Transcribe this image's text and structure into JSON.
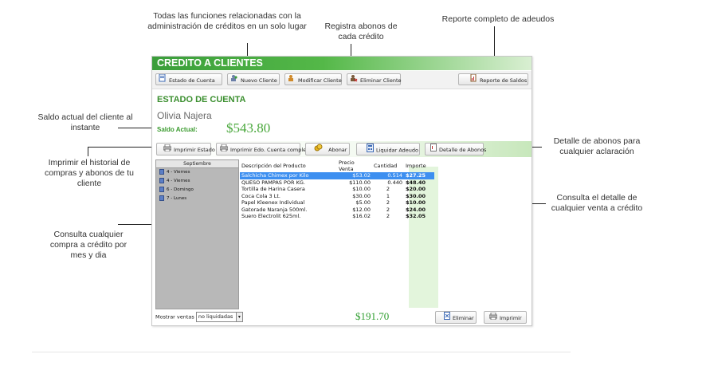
{
  "callouts": {
    "top_funcs": "Todas las funciones relacionadas con la administración de créditos en un solo lugar",
    "abonos": "Registra abonos de cada crédito",
    "reporte": "Reporte completo de adeudos",
    "saldo": "Saldo actual del cliente al instante",
    "detalle_abonos": "Detalle de abonos para cualquier aclaración",
    "imprimir_hist": "Imprimir el historial de compras y abonos de tu cliente",
    "detalle_venta": "Consulta el detalle de cualquier venta a crédito",
    "consulta_mes": "Consulta cualquier compra a crédito por mes y dia"
  },
  "window": {
    "title": "CREDITO A CLIENTES",
    "toolbar": {
      "estado": "Estado de Cuenta",
      "nuevo": "Nuevo Cliente",
      "modificar": "Modificar Cliente",
      "eliminar": "Eliminar Cliente",
      "reporte": "Reporte de Saldos"
    },
    "section_title": "ESTADO DE CUENTA",
    "client_name": "Olivia Najera",
    "saldo_label": "Saldo Actual:",
    "saldo_value": "$543.80",
    "actions": {
      "imprimir": "Imprimir Estado",
      "imprimir_completo": "Imprimir Edo. Cuenta completo",
      "abonar": "Abonar",
      "liquidar": "Liquidar Adeudo",
      "detalle": "Detalle de Abonos"
    },
    "months": {
      "header": "Septiembre",
      "days": [
        "4 - Viernes",
        "4 - Viernes",
        "6 - Domingo",
        "7 - Lunes"
      ]
    },
    "table": {
      "headers": [
        "Descripción del Producto",
        "Precio Venta",
        "Cantidad",
        "Importe"
      ],
      "rows": [
        [
          "Salchicha Chimex por Kilo",
          "$53.02",
          "0.514",
          "$27.25"
        ],
        [
          "QUESO PAMPAS POR KG.",
          "$110.00",
          "0.440",
          "$48.40"
        ],
        [
          "Tortilla de Harina Casera",
          "$10.00",
          "2",
          "$20.00"
        ],
        [
          "Coca Cola 3 Lt.",
          "$30.00",
          "1",
          "$30.00"
        ],
        [
          "Papel Kleenex Individual",
          "$5.00",
          "2",
          "$10.00"
        ],
        [
          "Gatorade Naranja 500ml.",
          "$12.00",
          "2",
          "$24.00"
        ],
        [
          "Suero Electrolit 625ml.",
          "$16.02",
          "2",
          "$32.05"
        ]
      ]
    },
    "footer": {
      "mostrar_label": "Mostrar ventas",
      "mostrar_value": "no liquidadas",
      "total": "$191.70",
      "eliminar": "Eliminar",
      "imprimir": "Imprimir"
    }
  },
  "colors": {
    "accent": "#54b848",
    "selected_row": "#3d8ff0",
    "amount_green": "#2f9e2f"
  }
}
